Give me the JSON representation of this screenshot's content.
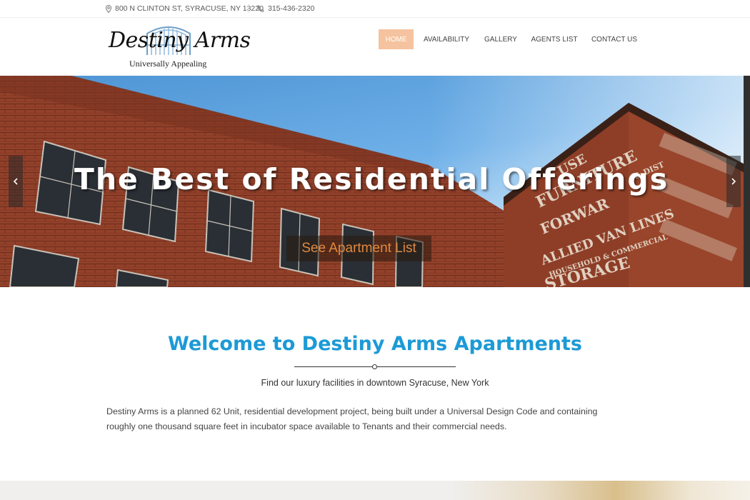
{
  "topbar": {
    "address": "800 N CLINTON ST, SYRACUSE, NY 13220",
    "phone": "315-436-2320",
    "address_icon": "map-pin-icon",
    "phone_icon": "phone-icon"
  },
  "logo": {
    "name": "Destiny Arms",
    "tagline": "Universally Appealing"
  },
  "nav": {
    "items": [
      {
        "label": "HOME",
        "active": true
      },
      {
        "label": "AVAILABILITY",
        "active": false
      },
      {
        "label": "GALLERY",
        "active": false
      },
      {
        "label": "AGENTS LIST",
        "active": false
      },
      {
        "label": "CONTACT US",
        "active": false
      }
    ]
  },
  "hero": {
    "title": "The Best of Residential Offerings",
    "cta": "See Apartment List",
    "prev_icon": "chevron-left-icon",
    "next_icon": "chevron-right-icon",
    "sign_lines": [
      "USE",
      "FURNITURE",
      "FORWAR",
      "& DIST",
      "ALLIED VAN LINES",
      "HOUSEHOLD & COMMERCIAL",
      "STORAGE"
    ]
  },
  "welcome": {
    "title": "Welcome to Destiny Arms Apartments",
    "subtitle": "Find our luxury facilities in downtown Syracuse, New York",
    "body": "Destiny Arms is a planned 62 Unit, residential development project, being built under a Universal Design Code and containing roughly one thousand square feet in incubator space available to Tenants and their commercial needs."
  },
  "colors": {
    "accent": "#1d9ad6",
    "nav_active_bg": "#f5c39f",
    "cta_text": "#e2893d",
    "brick": "#8a3b24"
  }
}
